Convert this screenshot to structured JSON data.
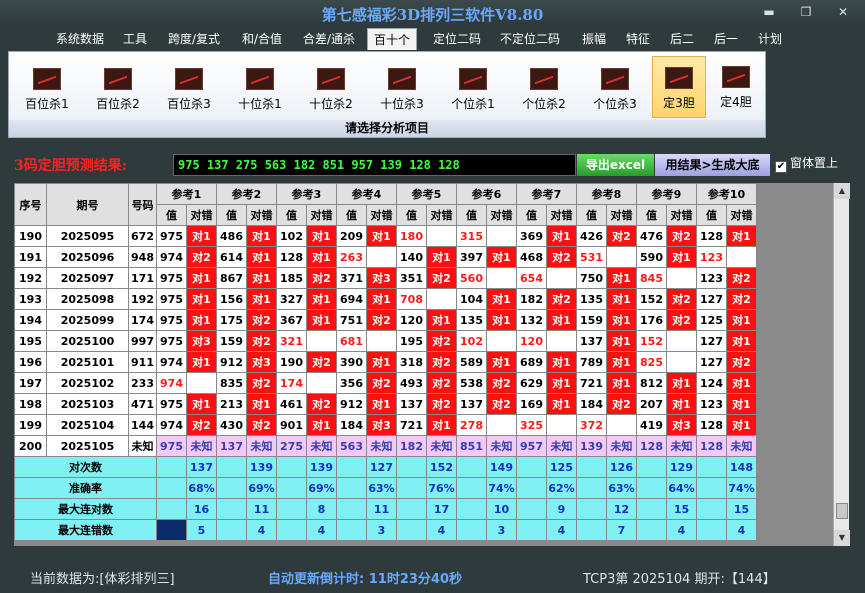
{
  "app": {
    "title": "第七感福彩3D排列三软件V8.80"
  },
  "menu": [
    "系统数据",
    "工具",
    "跨度/复式",
    "和/合值",
    "合差/通杀",
    "百十个",
    "定位二码",
    "不定位二码",
    "振幅",
    "特征",
    "后二",
    "后一",
    "计划"
  ],
  "menu_active": "百十个",
  "ribbon": {
    "buttons": [
      "百位杀1",
      "百位杀2",
      "百位杀3",
      "十位杀1",
      "十位杀2",
      "十位杀3",
      "个位杀1",
      "个位杀2",
      "个位杀3",
      "定3胆",
      "定4胆"
    ],
    "selected": "定3胆",
    "footer": "请选择分析项目"
  },
  "predict": {
    "label": "3码定胆预测结果:",
    "value": "975 137 275 563 182 851 957 139 128 128",
    "export_label": "导出excel",
    "generate_label": "用结果>生成大底",
    "topmost_label": "窗体置上"
  },
  "table": {
    "headers": {
      "seq": "序号",
      "issue": "期号",
      "code": "号码"
    },
    "ref_headers": [
      "参考1",
      "参考2",
      "参考3",
      "参考4",
      "参考5",
      "参考6",
      "参考7",
      "参考8",
      "参考9",
      "参考10"
    ],
    "sub_value": "值",
    "sub_result": "对错",
    "rows": [
      {
        "seq": "190",
        "issue": "2025095",
        "code": "672",
        "cells": [
          [
            "975",
            "对1"
          ],
          [
            "486",
            "对1"
          ],
          [
            "102",
            "对1"
          ],
          [
            "209",
            "对1"
          ],
          [
            "180",
            ""
          ],
          [
            "315",
            ""
          ],
          [
            "369",
            "对1"
          ],
          [
            "426",
            "对2"
          ],
          [
            "476",
            "对2"
          ],
          [
            "128",
            "对1"
          ]
        ]
      },
      {
        "seq": "191",
        "issue": "2025096",
        "code": "948",
        "cells": [
          [
            "974",
            "对2"
          ],
          [
            "614",
            "对1"
          ],
          [
            "128",
            "对1"
          ],
          [
            "263",
            ""
          ],
          [
            "140",
            "对1"
          ],
          [
            "397",
            "对1"
          ],
          [
            "468",
            "对2"
          ],
          [
            "531",
            ""
          ],
          [
            "590",
            "对1"
          ],
          [
            "123",
            ""
          ]
        ]
      },
      {
        "seq": "192",
        "issue": "2025097",
        "code": "171",
        "cells": [
          [
            "975",
            "对1"
          ],
          [
            "867",
            "对1"
          ],
          [
            "185",
            "对2"
          ],
          [
            "371",
            "对3"
          ],
          [
            "351",
            "对2"
          ],
          [
            "560",
            ""
          ],
          [
            "654",
            ""
          ],
          [
            "750",
            "对1"
          ],
          [
            "845",
            ""
          ],
          [
            "123",
            "对2"
          ]
        ]
      },
      {
        "seq": "193",
        "issue": "2025098",
        "code": "192",
        "cells": [
          [
            "975",
            "对1"
          ],
          [
            "156",
            "对1"
          ],
          [
            "327",
            "对1"
          ],
          [
            "694",
            "对1"
          ],
          [
            "708",
            ""
          ],
          [
            "104",
            "对1"
          ],
          [
            "182",
            "对2"
          ],
          [
            "135",
            "对1"
          ],
          [
            "152",
            "对2"
          ],
          [
            "127",
            "对2"
          ]
        ]
      },
      {
        "seq": "194",
        "issue": "2025099",
        "code": "174",
        "cells": [
          [
            "975",
            "对1"
          ],
          [
            "175",
            "对2"
          ],
          [
            "367",
            "对1"
          ],
          [
            "751",
            "对2"
          ],
          [
            "120",
            "对1"
          ],
          [
            "135",
            "对1"
          ],
          [
            "132",
            "对1"
          ],
          [
            "159",
            "对1"
          ],
          [
            "176",
            "对2"
          ],
          [
            "125",
            "对1"
          ]
        ]
      },
      {
        "seq": "195",
        "issue": "2025100",
        "code": "997",
        "cells": [
          [
            "975",
            "对3"
          ],
          [
            "159",
            "对2"
          ],
          [
            "321",
            ""
          ],
          [
            "681",
            ""
          ],
          [
            "195",
            "对2"
          ],
          [
            "102",
            ""
          ],
          [
            "120",
            ""
          ],
          [
            "137",
            "对1"
          ],
          [
            "152",
            ""
          ],
          [
            "127",
            "对1"
          ]
        ]
      },
      {
        "seq": "196",
        "issue": "2025101",
        "code": "911",
        "cells": [
          [
            "974",
            "对1"
          ],
          [
            "912",
            "对3"
          ],
          [
            "190",
            "对2"
          ],
          [
            "390",
            "对1"
          ],
          [
            "318",
            "对2"
          ],
          [
            "589",
            "对1"
          ],
          [
            "689",
            "对1"
          ],
          [
            "789",
            "对1"
          ],
          [
            "825",
            ""
          ],
          [
            "127",
            "对2"
          ]
        ]
      },
      {
        "seq": "197",
        "issue": "2025102",
        "code": "233",
        "cells": [
          [
            "974",
            ""
          ],
          [
            "835",
            "对2"
          ],
          [
            "174",
            ""
          ],
          [
            "356",
            "对2"
          ],
          [
            "493",
            "对2"
          ],
          [
            "538",
            "对2"
          ],
          [
            "629",
            "对1"
          ],
          [
            "721",
            "对1"
          ],
          [
            "812",
            "对1"
          ],
          [
            "124",
            "对1"
          ]
        ]
      },
      {
        "seq": "198",
        "issue": "2025103",
        "code": "471",
        "cells": [
          [
            "975",
            "对1"
          ],
          [
            "213",
            "对1"
          ],
          [
            "461",
            "对2"
          ],
          [
            "912",
            "对1"
          ],
          [
            "137",
            "对2"
          ],
          [
            "137",
            "对2"
          ],
          [
            "169",
            "对1"
          ],
          [
            "184",
            "对2"
          ],
          [
            "207",
            "对1"
          ],
          [
            "123",
            "对1"
          ]
        ]
      },
      {
        "seq": "199",
        "issue": "2025104",
        "code": "144",
        "cells": [
          [
            "974",
            "对2"
          ],
          [
            "430",
            "对2"
          ],
          [
            "901",
            "对1"
          ],
          [
            "184",
            "对3"
          ],
          [
            "721",
            "对1"
          ],
          [
            "278",
            ""
          ],
          [
            "325",
            ""
          ],
          [
            "372",
            ""
          ],
          [
            "419",
            "对3"
          ],
          [
            "128",
            "对1"
          ]
        ]
      }
    ],
    "pending_row": {
      "seq": "200",
      "issue": "2025105",
      "code": "未知",
      "cells": [
        [
          "975",
          "未知"
        ],
        [
          "137",
          "未知"
        ],
        [
          "275",
          "未知"
        ],
        [
          "563",
          "未知"
        ],
        [
          "182",
          "未知"
        ],
        [
          "851",
          "未知"
        ],
        [
          "957",
          "未知"
        ],
        [
          "139",
          "未知"
        ],
        [
          "128",
          "未知"
        ],
        [
          "128",
          "未知"
        ]
      ]
    },
    "stats": [
      {
        "label": "对次数",
        "values": [
          "137",
          "139",
          "139",
          "127",
          "152",
          "149",
          "125",
          "126",
          "129",
          "148"
        ]
      },
      {
        "label": "准确率",
        "values": [
          "68%",
          "69%",
          "69%",
          "63%",
          "76%",
          "74%",
          "62%",
          "63%",
          "64%",
          "74%"
        ]
      },
      {
        "label": "最大连对数",
        "values": [
          "16",
          "11",
          "8",
          "11",
          "17",
          "10",
          "9",
          "12",
          "15",
          "15"
        ]
      },
      {
        "label": "最大连错数",
        "values": [
          "5",
          "4",
          "4",
          "3",
          "4",
          "3",
          "4",
          "7",
          "4",
          "4"
        ]
      }
    ]
  },
  "status": {
    "current": "当前数据为:[体彩排列三]",
    "countdown": "自动更新倒计时: 11时23分40秒",
    "issue": "TCP3第 2025104 期开:【144】"
  },
  "colors": {
    "hit": "#ff1010",
    "miss_text": "#ff1a1a",
    "pending": "#f6c8f6",
    "stats": "#7ff0f4",
    "accent": "#6aa8ff"
  }
}
